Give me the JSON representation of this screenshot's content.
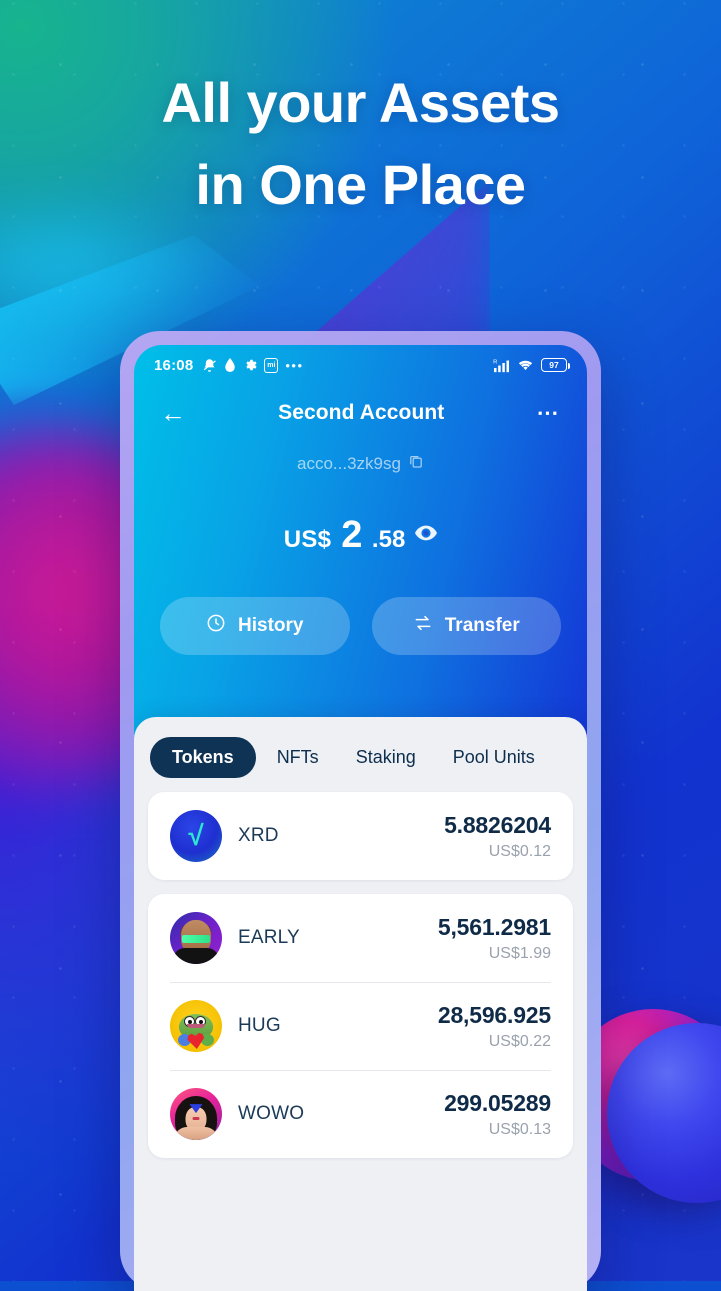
{
  "promo": {
    "headline_line1": "All your Assets",
    "headline_line2": "in One Place"
  },
  "status_bar": {
    "time": "16:08",
    "icons": [
      "bell-off-icon",
      "water-drop-icon",
      "gear-icon",
      "mi-badge-icon",
      "more-dots-icon"
    ],
    "mi_label": "mi",
    "dots": "•••",
    "roaming_label": "R",
    "battery_percent": "97"
  },
  "app_bar": {
    "back_icon": "back-arrow-icon",
    "title": "Second Account",
    "menu_icon": "kebab-menu-icon"
  },
  "account": {
    "address": "acco...3zk9sg",
    "copy_icon": "copy-icon",
    "currency": "US$",
    "balance_integer": "2",
    "balance_decimal": ".58",
    "visibility_icon": "eye-icon"
  },
  "actions": {
    "history_label": "History",
    "history_icon": "clock-icon",
    "transfer_label": "Transfer",
    "transfer_icon": "swap-arrows-icon"
  },
  "tabs": [
    {
      "label": "Tokens",
      "active": true
    },
    {
      "label": "NFTs",
      "active": false
    },
    {
      "label": "Staking",
      "active": false
    },
    {
      "label": "Pool Units",
      "active": false
    }
  ],
  "token_groups": [
    {
      "tokens": [
        {
          "symbol": "XRD",
          "amount": "5.8826204",
          "fiat": "US$0.12",
          "icon": "xrd-token-icon"
        }
      ]
    },
    {
      "tokens": [
        {
          "symbol": "EARLY",
          "amount": "5,561.2981",
          "fiat": "US$1.99",
          "icon": "early-token-icon"
        },
        {
          "symbol": "HUG",
          "amount": "28,596.925",
          "fiat": "US$0.22",
          "icon": "hug-token-icon"
        },
        {
          "symbol": "WOWO",
          "amount": "299.05289",
          "fiat": "US$0.13",
          "icon": "wowo-token-icon"
        }
      ]
    }
  ],
  "colors": {
    "screen_gradient_start": "#00bfe8",
    "screen_gradient_end": "#142ecb",
    "tab_active_bg": "#0f3354",
    "amount_text": "#0f2b48",
    "fiat_text": "#9aa2ad",
    "sheet_bg": "#eef0f4"
  }
}
